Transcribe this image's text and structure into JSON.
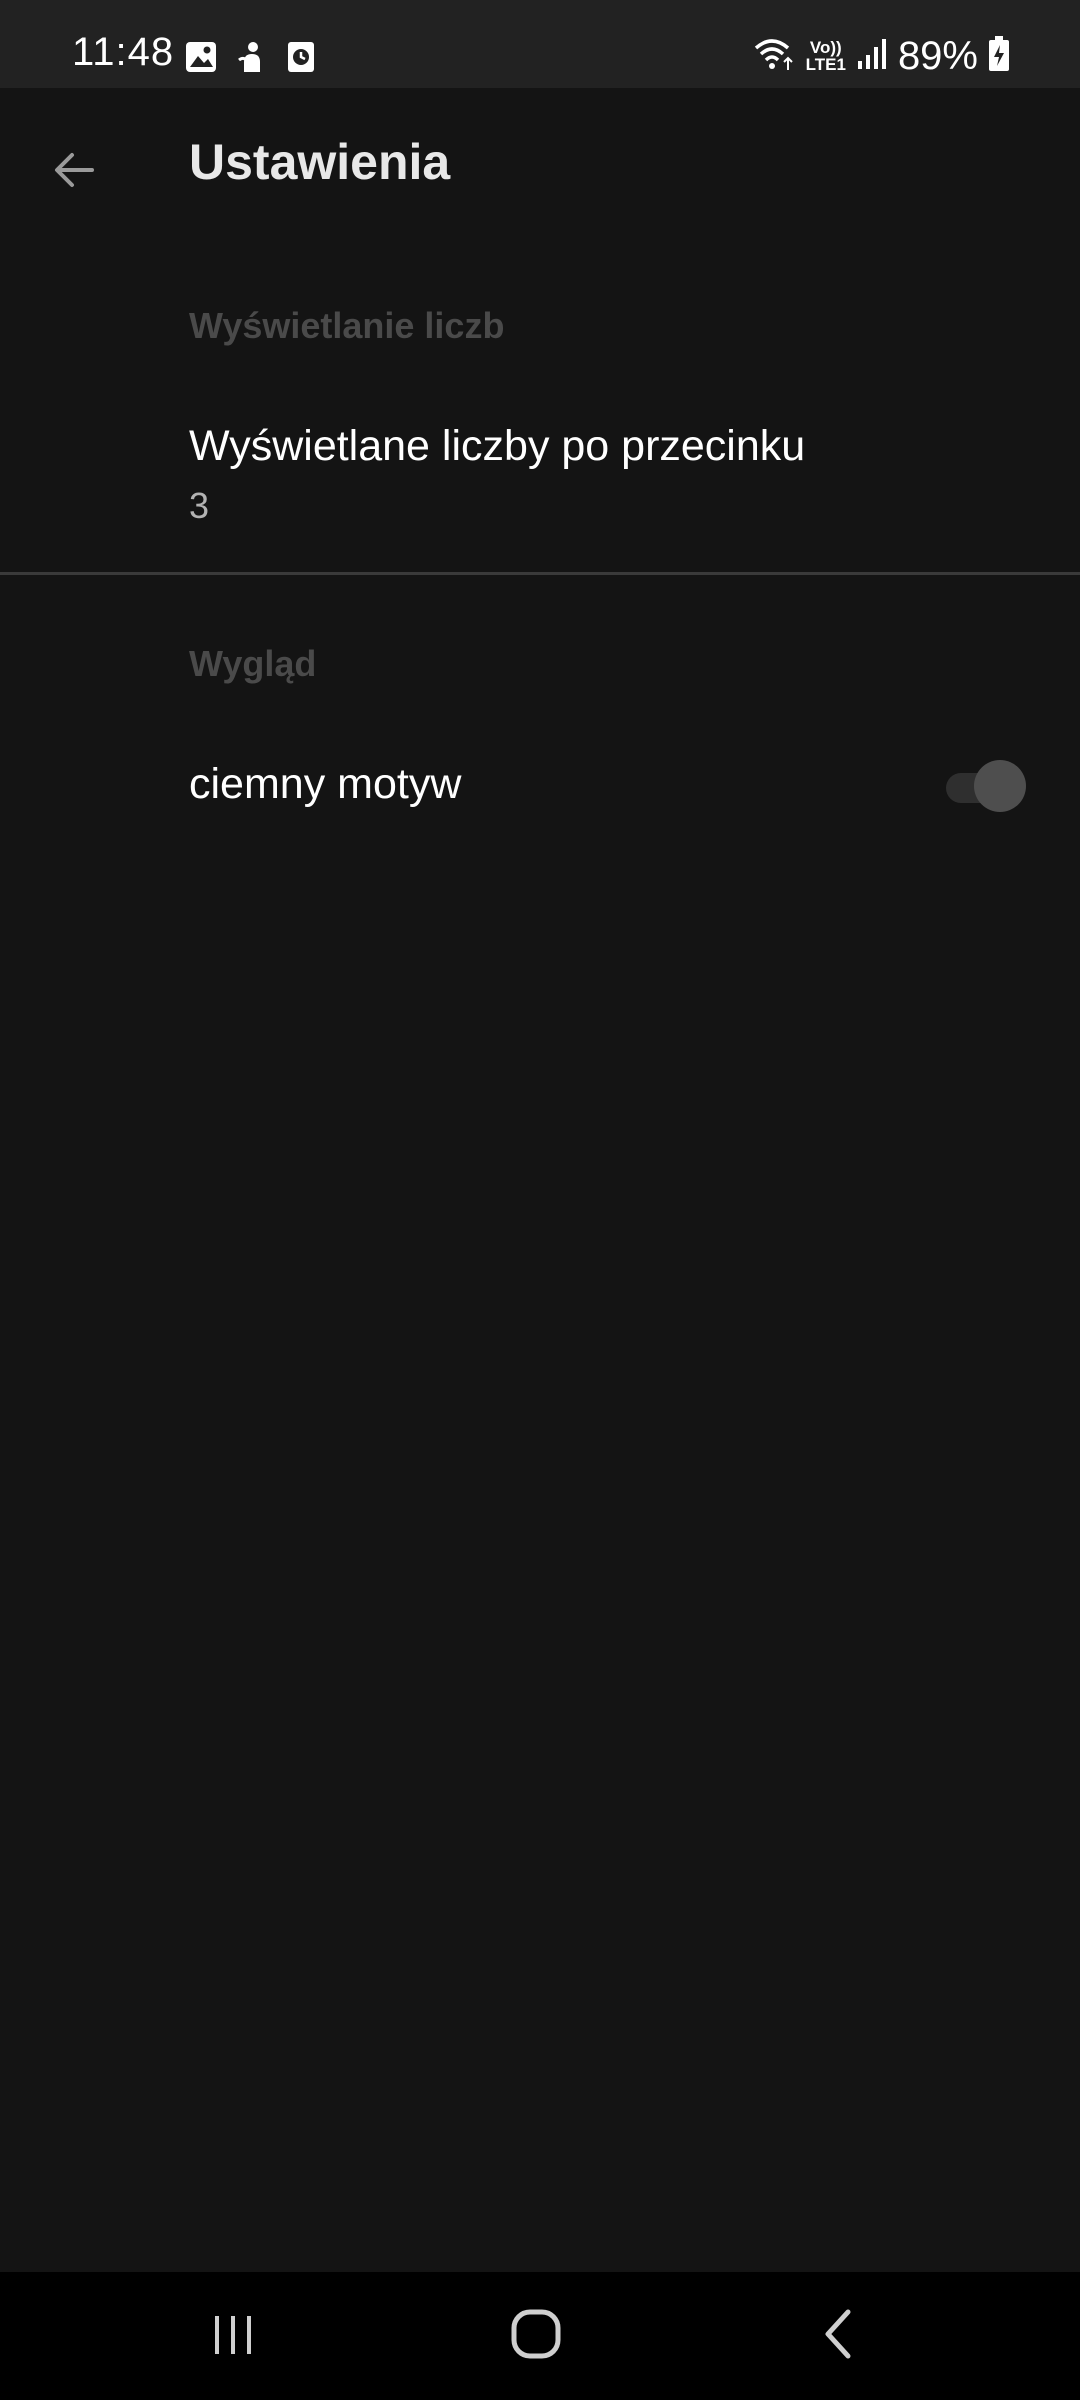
{
  "status_bar": {
    "time": "11:48",
    "battery": "89%",
    "network_top": "Vo))",
    "network_bottom": "LTE1",
    "left_icons": [
      "image-icon",
      "app-notification-icon",
      "clock-app-icon"
    ],
    "right_icons": [
      "wifi-icon",
      "volte-icon",
      "signal-icon",
      "battery-charging-icon"
    ]
  },
  "toolbar": {
    "title": "Ustawienia",
    "back_icon": "arrow-back-icon"
  },
  "preferences": {
    "number_display": {
      "category": "Wyświetlanie liczb",
      "decimals_title": "Wyświetlane liczby po przecinku",
      "decimals_value": "3"
    },
    "appearance": {
      "category": "Wygląd",
      "dark_theme_title": "ciemny motyw",
      "dark_theme_enabled": false
    }
  },
  "navigation_bar": {
    "buttons": [
      "recent-apps-icon",
      "home-icon",
      "back-icon"
    ]
  },
  "colors": {
    "background": "#141414",
    "status_bar": "#222222",
    "category_text": "#4a4a4a",
    "primary_text": "#ffffff",
    "secondary_text": "#b3b3b3"
  }
}
